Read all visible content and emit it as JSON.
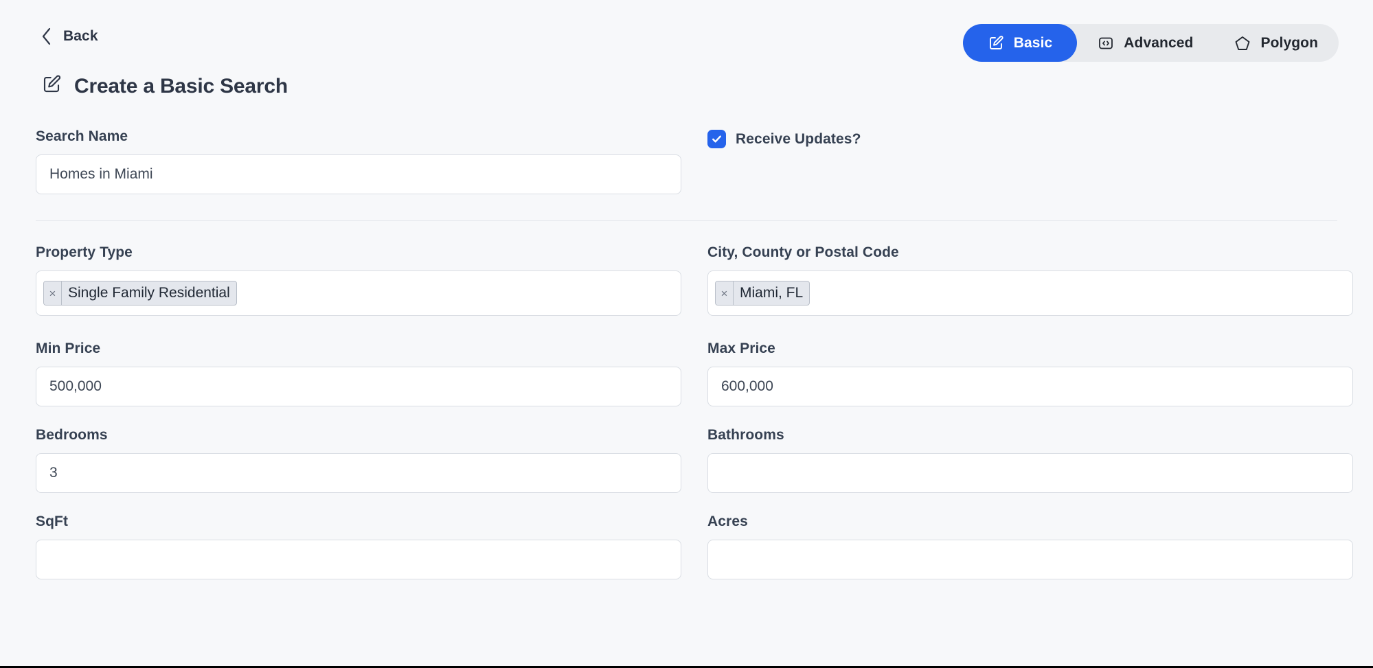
{
  "topbar": {
    "back_label": "Back",
    "back_icon": "chevron-left-icon",
    "tabs": [
      {
        "label": "Basic",
        "icon": "pencil-square-icon",
        "active": true
      },
      {
        "label": "Advanced",
        "icon": "code-brackets-icon",
        "active": false
      },
      {
        "label": "Polygon",
        "icon": "pentagon-icon",
        "active": false
      }
    ]
  },
  "header": {
    "title": "Create a Basic Search",
    "title_icon": "pencil-square-icon"
  },
  "form": {
    "search_name": {
      "label": "Search Name",
      "value": "Homes in Miami",
      "placeholder": ""
    },
    "receive_updates": {
      "label": "Receive Updates?",
      "checked": true,
      "icon": "check-icon"
    },
    "property_type": {
      "label": "Property Type",
      "chips": [
        {
          "label": "Single Family Residential",
          "remove_icon": "×"
        }
      ]
    },
    "location": {
      "label": "City, County or Postal Code",
      "chips": [
        {
          "label": "Miami, FL",
          "remove_icon": "×"
        }
      ]
    },
    "min_price": {
      "label": "Min Price",
      "value": "500,000",
      "placeholder": ""
    },
    "max_price": {
      "label": "Max Price",
      "value": "600,000",
      "placeholder": ""
    },
    "bedrooms": {
      "label": "Bedrooms",
      "value": "3",
      "placeholder": ""
    },
    "bathrooms": {
      "label": "Bathrooms",
      "value": "",
      "placeholder": ""
    },
    "sqft": {
      "label": "SqFt",
      "value": "",
      "placeholder": ""
    },
    "acres": {
      "label": "Acres",
      "value": "",
      "placeholder": ""
    }
  },
  "colors": {
    "accent": "#2563eb",
    "page_bg": "#f7f8fa",
    "tabstrip_bg": "#e8eaed",
    "input_bg": "#ffffff",
    "border": "#d9dde3",
    "text": "#2e3646"
  }
}
